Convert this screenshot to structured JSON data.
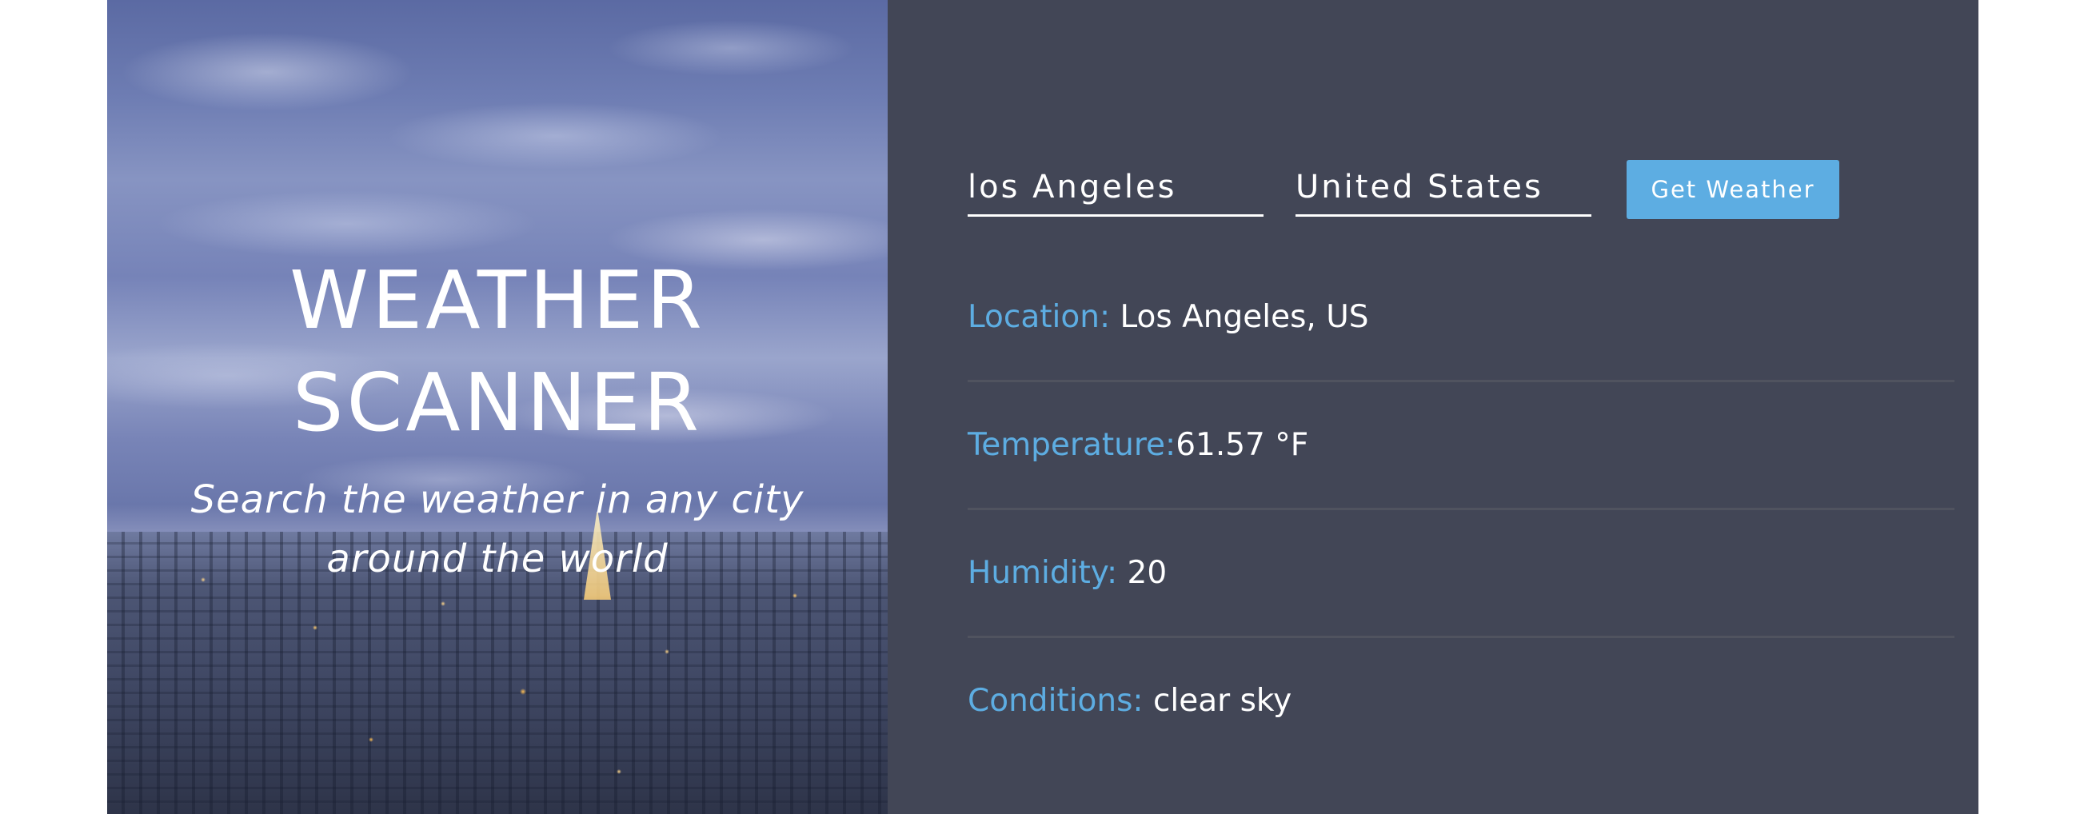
{
  "hero": {
    "title_line1": "WEATHER",
    "title_line2": "SCANNER",
    "subtitle": "Search the weather in any city around the world"
  },
  "form": {
    "city_value": "los Angeles",
    "country_value": "United States",
    "submit_label": "Get Weather"
  },
  "results": {
    "location": {
      "label": "Location:",
      "value": " Los Angeles, US"
    },
    "temperature": {
      "label": "Temperature:",
      "value": "61.57 °F"
    },
    "humidity": {
      "label": "Humidity:",
      "value": " 20"
    },
    "conditions": {
      "label": "Conditions:",
      "value": " clear sky"
    }
  },
  "colors": {
    "panel_background": "#424656",
    "accent": "#5dade2",
    "divider": "#50535f",
    "text": "#ffffff"
  }
}
